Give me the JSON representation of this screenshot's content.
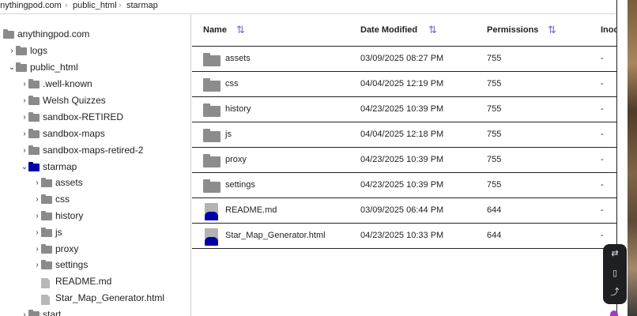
{
  "breadcrumb": [
    "anythingpod.com",
    "public_html",
    "starmap"
  ],
  "tree": [
    {
      "label": "anythingpod.com",
      "chevron": "",
      "icon": "folder"
    },
    {
      "label": "logs",
      "chevron": "›",
      "icon": "folder"
    },
    {
      "label": "public_html",
      "chevron": "⌄",
      "icon": "folder"
    },
    {
      "label": ".well-known",
      "chevron": "›",
      "icon": "folder"
    },
    {
      "label": "Welsh Quizzes",
      "chevron": "›",
      "icon": "folder"
    },
    {
      "label": "sandbox-RETIRED",
      "chevron": "›",
      "icon": "folder"
    },
    {
      "label": "sandbox-maps",
      "chevron": "›",
      "icon": "folder"
    },
    {
      "label": "sandbox-maps-retired-2",
      "chevron": "›",
      "icon": "folder"
    },
    {
      "label": "starmap",
      "chevron": "⌄",
      "icon": "folder-open"
    },
    {
      "label": "assets",
      "chevron": "›",
      "icon": "folder"
    },
    {
      "label": "css",
      "chevron": "›",
      "icon": "folder"
    },
    {
      "label": "history",
      "chevron": "›",
      "icon": "folder"
    },
    {
      "label": "js",
      "chevron": "›",
      "icon": "folder"
    },
    {
      "label": "proxy",
      "chevron": "›",
      "icon": "folder"
    },
    {
      "label": "settings",
      "chevron": "›",
      "icon": "folder"
    },
    {
      "label": "README.md",
      "chevron": "",
      "icon": "file"
    },
    {
      "label": "Star_Map_Generator.html",
      "chevron": "",
      "icon": "file"
    },
    {
      "label": "start",
      "chevron": "›",
      "icon": "folder"
    }
  ],
  "table": {
    "headers": {
      "name": "Name",
      "date": "Date Modified",
      "perm": "Permissions",
      "inode": "Inod"
    },
    "sort_icon": "⇅",
    "rows": [
      {
        "type": "folder",
        "name": "assets",
        "date": "03/09/2025 08:27 PM",
        "perm": "755",
        "inode": "-"
      },
      {
        "type": "folder",
        "name": "css",
        "date": "04/04/2025 12:19 PM",
        "perm": "755",
        "inode": "-"
      },
      {
        "type": "folder",
        "name": "history",
        "date": "04/23/2025 10:39 PM",
        "perm": "755",
        "inode": "-"
      },
      {
        "type": "folder",
        "name": "js",
        "date": "04/04/2025 12:18 PM",
        "perm": "755",
        "inode": "-"
      },
      {
        "type": "folder",
        "name": "proxy",
        "date": "04/23/2025 10:39 PM",
        "perm": "755",
        "inode": "-"
      },
      {
        "type": "folder",
        "name": "settings",
        "date": "04/23/2025 10:39 PM",
        "perm": "755",
        "inode": "-"
      },
      {
        "type": "file",
        "name": "README.md",
        "date": "03/09/2025 06:44 PM",
        "perm": "644",
        "inode": "-"
      },
      {
        "type": "file",
        "name": "Star_Map_Generator.html",
        "date": "04/23/2025 10:33 PM",
        "perm": "644",
        "inode": "-"
      }
    ]
  },
  "float_toolbar": [
    "translate-icon",
    "book-icon",
    "share-icon"
  ],
  "colors": {
    "accent": "#0000a8",
    "folder": "#8a8a8a",
    "sort": "#6b6bdc"
  }
}
